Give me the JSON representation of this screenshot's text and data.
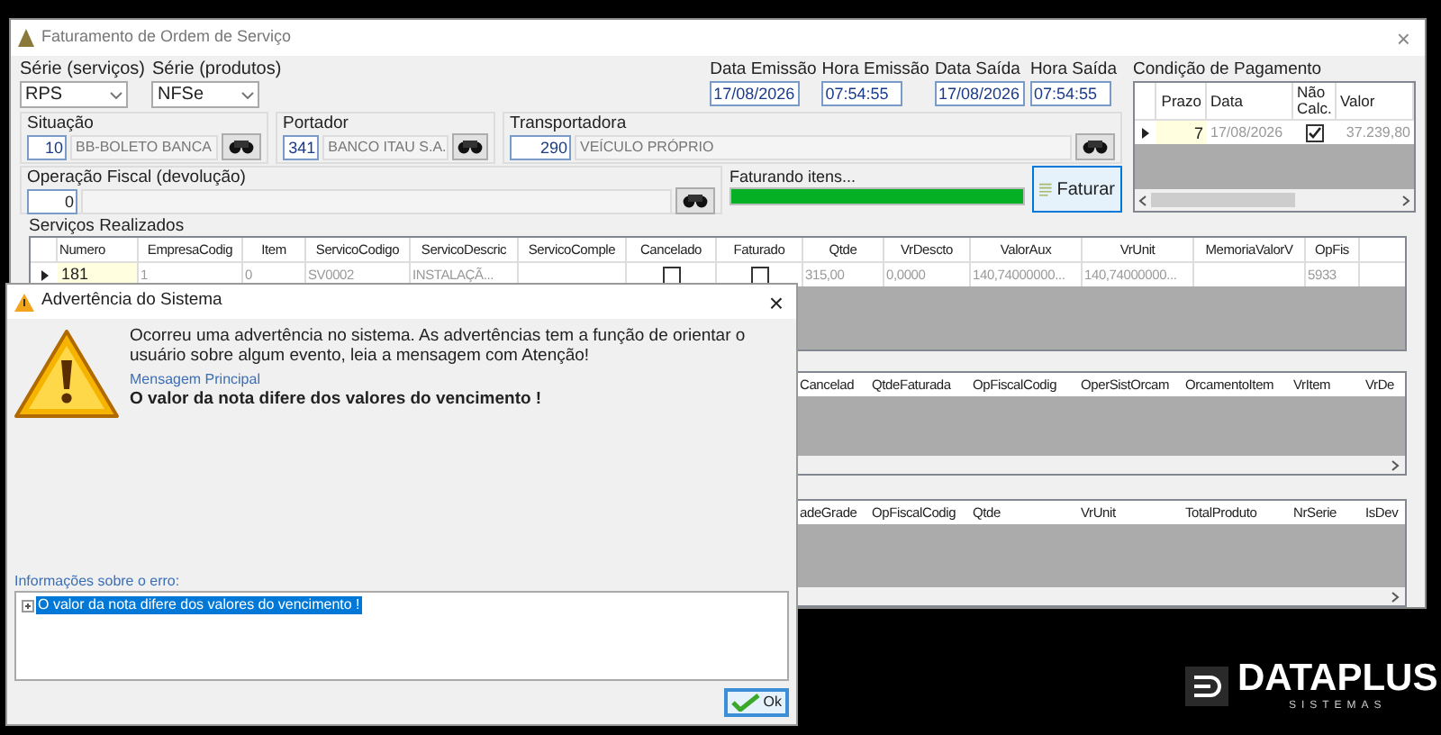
{
  "desktop": {
    "brand": "DATAPLUS",
    "tagline": "SISTEMAS"
  },
  "window": {
    "title": "Faturamento de Ordem de Serviço",
    "close": "×"
  },
  "series": [
    {
      "label": "Série (serviços)",
      "value": "RPS"
    },
    {
      "label": "Série (produtos)",
      "value": "NFSe"
    }
  ],
  "dates": [
    {
      "label": "Data Emissão",
      "value": "17/08/2026"
    },
    {
      "label": "Hora Emissão",
      "value": "07:54:55"
    },
    {
      "label": "Data Saída",
      "value": "17/08/2026"
    },
    {
      "label": "Hora Saída",
      "value": "07:54:55"
    }
  ],
  "condicao_pagamento": {
    "title": "Condição de Pagamento",
    "columns": [
      "Prazo",
      "Data",
      "Não Calc.",
      "Valor"
    ],
    "rows": [
      {
        "prazo": "7",
        "data": "17/08/2026",
        "nao_calc": true,
        "valor": "37.239,80"
      }
    ]
  },
  "lookups": [
    {
      "label": "Situação",
      "code": "10",
      "name": "BB-BOLETO BANCA"
    },
    {
      "label": "Portador",
      "code": "341",
      "name": "BANCO ITAU S.A."
    },
    {
      "label": "Transportadora",
      "code": "290",
      "name": "VEÍCULO PRÓPRIO"
    }
  ],
  "operacao_fiscal": {
    "label": "Operação Fiscal (devolução)",
    "code": "0"
  },
  "progress": {
    "label": "Faturando itens...",
    "level": 1
  },
  "faturar_button": "Faturar",
  "servicos": {
    "title": "Serviços Realizados",
    "columns": [
      "Numero",
      "EmpresaCodig",
      "Item",
      "ServicoCodigo",
      "ServicoDescric",
      "ServicoComple",
      "Cancelado",
      "Faturado",
      "Qtde",
      "VrDescto",
      "ValorAux",
      "VrUnit",
      "MemoriaValorV",
      "OpFis"
    ],
    "rows": [
      {
        "cells": [
          {
            "kind": "key",
            "text": "181"
          },
          {
            "kind": "text",
            "text": "1"
          },
          {
            "kind": "text",
            "text": "0"
          },
          {
            "kind": "text",
            "text": "SV0002"
          },
          {
            "kind": "text",
            "text": "INSTALAÇÃ..."
          },
          {
            "kind": "blank"
          },
          {
            "kind": "check",
            "checked": false
          },
          {
            "kind": "check",
            "checked": false
          },
          {
            "kind": "text",
            "text": "315,00"
          },
          {
            "kind": "text",
            "text": "0,0000"
          },
          {
            "kind": "text",
            "text": "140,74000000..."
          },
          {
            "kind": "text",
            "text": "140,74000000..."
          },
          {
            "kind": "blank"
          },
          {
            "kind": "text",
            "text": "5933"
          }
        ]
      }
    ]
  },
  "grid_2": {
    "columns": [
      "Cancelad",
      "QtdeFaturada",
      "OpFiscalCodig",
      "OperSistOrcam",
      "OrcamentoItem",
      "VrItem",
      "VrDe"
    ]
  },
  "grid_3": {
    "columns": [
      "adeGrade",
      "OpFiscalCodig",
      "Qtde",
      "VrUnit",
      "TotalProduto",
      "NrSerie",
      "IsDev"
    ]
  },
  "dialog": {
    "title": "Advertência do Sistema",
    "close": "×",
    "message": "Ocorreu uma advertência no sistema. As advertências tem a função de orientar o usuário sobre algum evento, leia a mensagem com Atenção!",
    "section_label": "Mensagem Principal",
    "main_message": "O valor da nota difere dos valores do vencimento !",
    "details_label": "Informações sobre o erro:",
    "details": [
      {
        "text": "O valor da nota difere dos valores do vencimento !",
        "selected": true,
        "expanded": false
      }
    ],
    "ok_button": "Ok"
  }
}
